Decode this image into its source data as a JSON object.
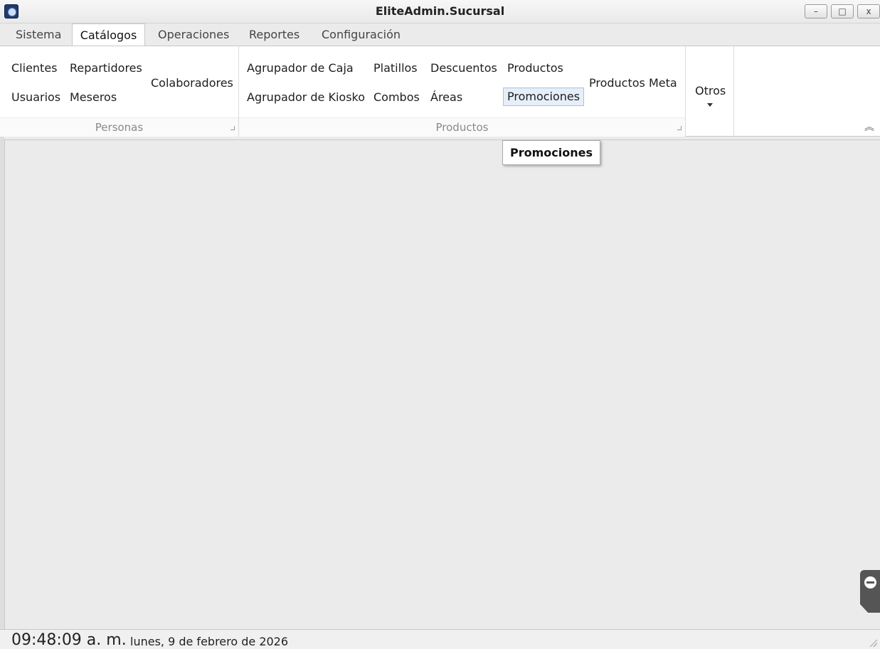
{
  "window": {
    "title": "EliteAdmin.Sucursal",
    "minimize_glyph": "–",
    "maximize_glyph": "□",
    "close_glyph": "x"
  },
  "tabs": [
    "Sistema",
    "Catálogos",
    "Operaciones",
    "Reportes",
    "Configuración"
  ],
  "active_tab": "Catálogos",
  "groups": {
    "personas": {
      "label": "Personas",
      "buttons": {
        "clientes": "Clientes",
        "repartidores": "Repartidores",
        "usuarios": "Usuarios",
        "meseros": "Meseros",
        "colaboradores": "Colaboradores"
      }
    },
    "productos": {
      "label": "Productos",
      "buttons": {
        "agrupador_caja": "Agrupador de Caja",
        "agrupador_kiosko": "Agrupador de Kiosko",
        "platillos": "Platillos",
        "combos": "Combos",
        "descuentos": "Descuentos",
        "areas": "Áreas",
        "productos": "Productos",
        "promociones": "Promociones",
        "productos_meta": "Productos Meta"
      }
    },
    "otros": {
      "label": "Otros"
    }
  },
  "tooltip": "Promociones",
  "status": {
    "time": "09:48:09 a. m.",
    "date": "lunes, 9 de febrero de 2026"
  },
  "icons": {
    "app": "app-icon",
    "collapse": "chevron-up-icon",
    "side_tab": "teamviewer-icon"
  }
}
